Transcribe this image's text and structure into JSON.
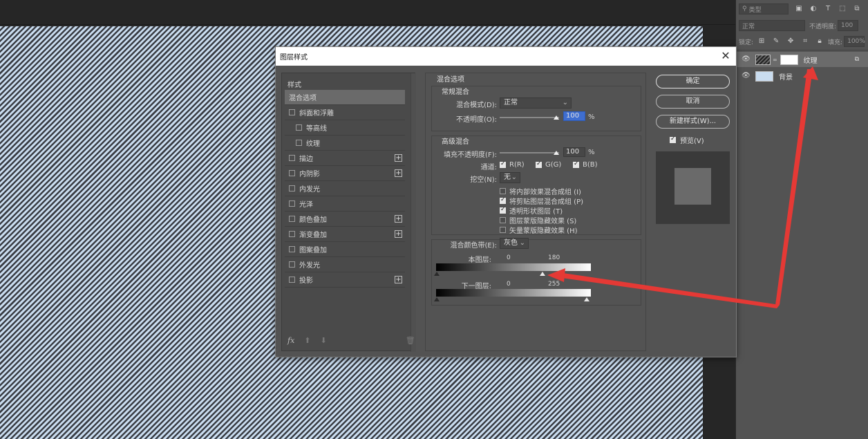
{
  "canvas": {
    "pattern": "diagonal-stripes",
    "stripe_colors": [
      "#c9dcef",
      "#3a3d44"
    ]
  },
  "layers_panel": {
    "search_placeholder": "类型",
    "blend_mode": "正常",
    "opacity_label": "不透明度:",
    "opacity_value": "100",
    "lock_label": "锁定:",
    "fill_label": "填充:",
    "fill_value": "100%",
    "layers": [
      {
        "name": "纹理",
        "visible": true
      },
      {
        "name": "背景",
        "visible": true
      }
    ]
  },
  "dialog": {
    "title": "图层样式",
    "styles_header": "样式",
    "style_items": [
      {
        "label": "混合选项",
        "selected": true
      },
      {
        "label": "斜面和浮雕"
      },
      {
        "label": "等高线"
      },
      {
        "label": "纹理"
      },
      {
        "label": "描边"
      },
      {
        "label": "内阴影"
      },
      {
        "label": "内发光"
      },
      {
        "label": "光泽"
      },
      {
        "label": "颜色叠加"
      },
      {
        "label": "渐变叠加"
      },
      {
        "label": "图案叠加"
      },
      {
        "label": "外发光"
      },
      {
        "label": "投影"
      }
    ],
    "fx_label": "fx",
    "blend_options": {
      "title": "混合选项",
      "general": {
        "title": "常规混合",
        "blend_mode_label": "混合模式(D):",
        "blend_mode_value": "正常",
        "opacity_label": "不透明度(O):",
        "opacity_value": "100",
        "percent": "%"
      },
      "advanced": {
        "title": "高级混合",
        "fill_opacity_label": "填充不透明度(F):",
        "fill_opacity_value": "100",
        "percent": "%",
        "channels_label": "通道:",
        "channel_r": "R(R)",
        "channel_g": "G(G)",
        "channel_b": "B(B)",
        "knockout_label": "挖空(N):",
        "knockout_value": "无",
        "options": [
          {
            "label": "将内部效果混合成组 (I)",
            "checked": false
          },
          {
            "label": "将剪贴图层混合成组 (P)",
            "checked": true
          },
          {
            "label": "透明形状图层 (T)",
            "checked": true
          },
          {
            "label": "图层蒙版隐藏效果 (S)",
            "checked": false
          },
          {
            "label": "矢量蒙版隐藏效果 (H)",
            "checked": false
          }
        ]
      },
      "blend_if": {
        "label": "混合颜色带(E):",
        "value": "灰色",
        "this_layer_label": "本图层:",
        "this_layer_low": "0",
        "this_layer_high": "180",
        "underlying_label": "下一图层:",
        "underlying_low": "0",
        "underlying_high": "255"
      }
    },
    "buttons": {
      "ok": "确定",
      "cancel": "取消",
      "new_style": "新建样式(W)...",
      "preview": "预览(V)"
    }
  },
  "annotation": {
    "color": "#e53935"
  }
}
